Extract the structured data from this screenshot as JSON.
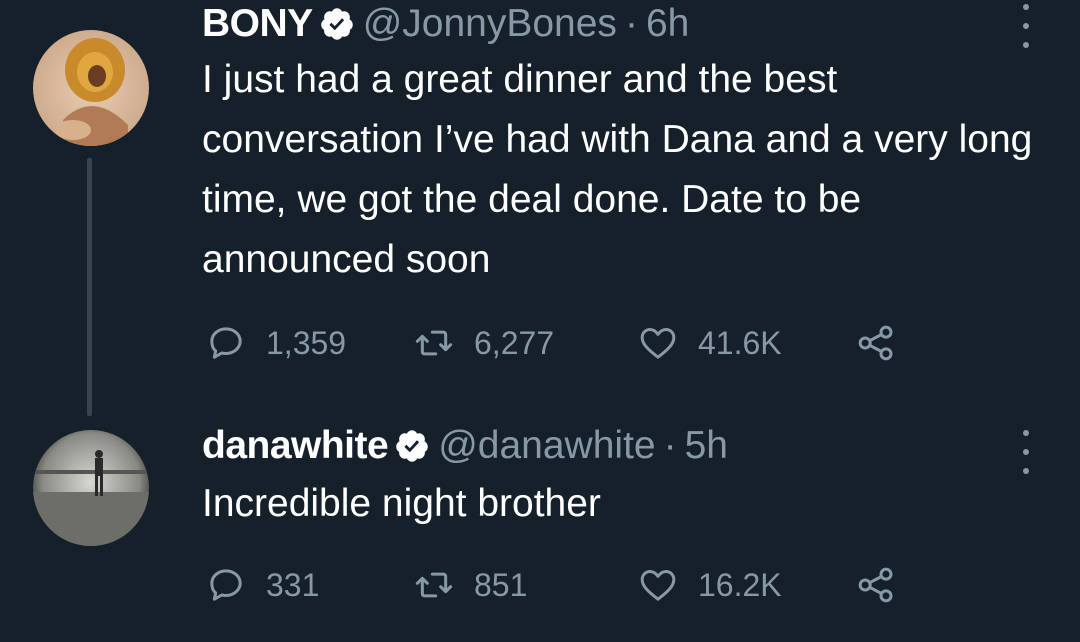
{
  "tweets": [
    {
      "display_name": "BONY",
      "handle": "@JonnyBones",
      "separator": "·",
      "time": "6h",
      "text": "I just had a great dinner and the best conversation I’ve had with Dana and a very long time, we got the deal done. Date to be announced soon",
      "verified": true,
      "replies": "1,359",
      "retweets": "6,277",
      "likes": "41.6K"
    },
    {
      "display_name": "danawhite",
      "handle": "@danawhite",
      "separator": "·",
      "time": "5h",
      "text": "Incredible night brother",
      "verified": true,
      "replies": "331",
      "retweets": "851",
      "likes": "16.2K"
    }
  ],
  "colors": {
    "background": "#15202b",
    "primary_text": "#ffffff",
    "secondary_text": "#8899a6",
    "thread_line": "#38444d"
  },
  "icons": [
    "verified-badge-icon",
    "more-options-icon",
    "reply-icon",
    "retweet-icon",
    "like-icon",
    "share-icon"
  ]
}
